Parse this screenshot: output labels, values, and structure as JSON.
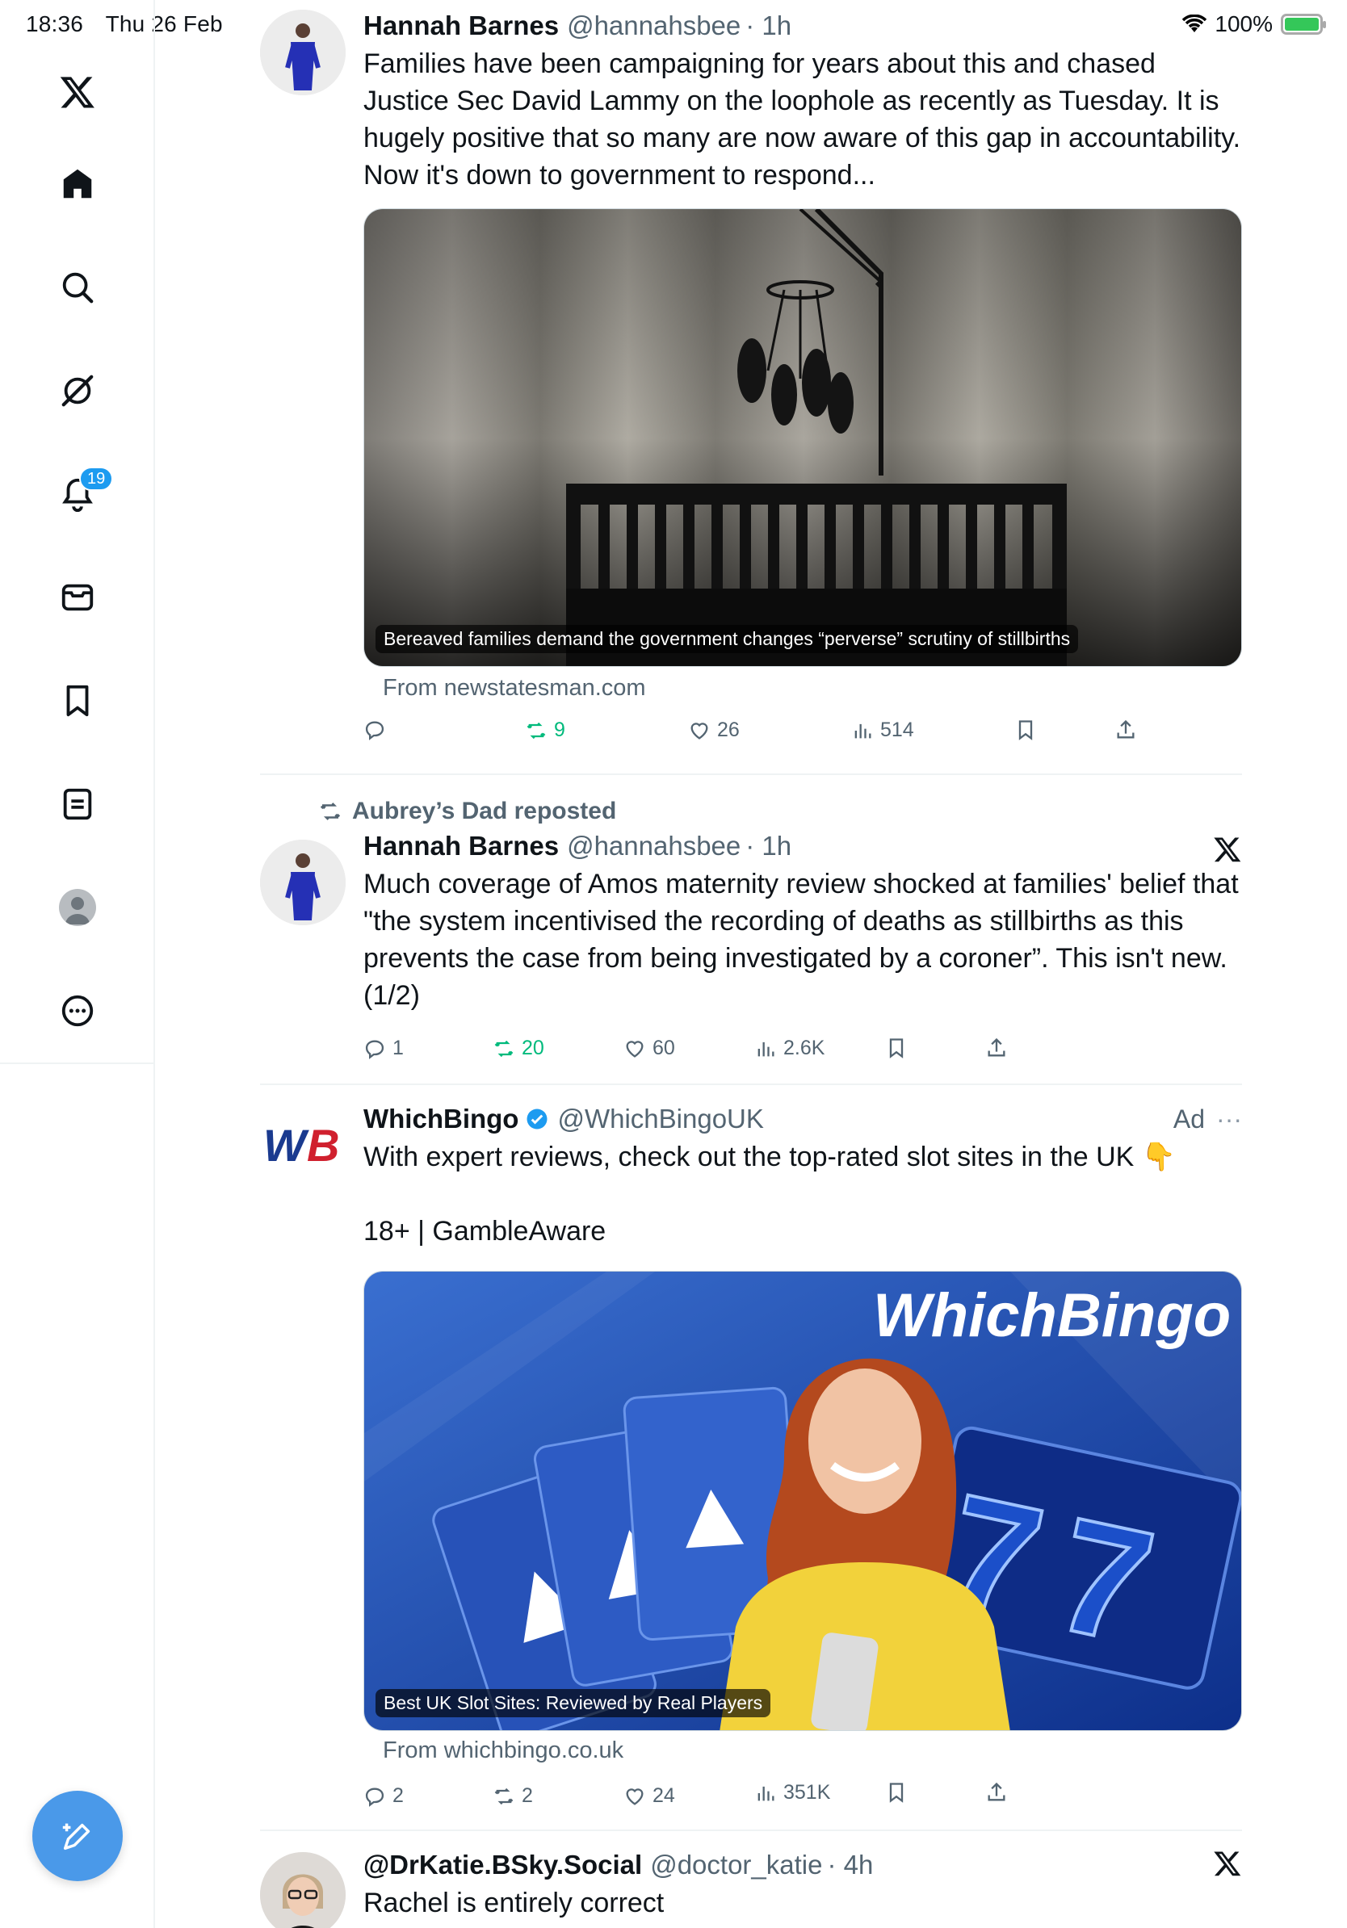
{
  "status_bar": {
    "time": "18:36",
    "date": "Thu 26 Feb",
    "battery": "100%"
  },
  "sidebar": {
    "notifications_badge": "19"
  },
  "tweets": [
    {
      "name": "Hannah Barnes",
      "handle": "@hannahsbee",
      "time": "· 1h",
      "text": "Families have been campaigning for years about this and chased Justice Sec David Lammy on the loophole as recently as Tuesday. It is hugely positive that so many are now aware of this gap in accountability. Now it's down to government to respond...",
      "card_caption": "Bereaved families demand the government changes “perverse” scrutiny of stillbirths",
      "card_source": "From newstatesman.com",
      "replies": "",
      "reposts": "9",
      "likes": "26",
      "views": "514"
    },
    {
      "reposted_by": "Aubrey’s Dad reposted",
      "name": "Hannah Barnes",
      "handle": "@hannahsbee",
      "time": "· 1h",
      "text": "Much coverage of Amos maternity review shocked at families' belief that \"the system incentivised the recording of deaths as stillbirths as this prevents the case from being investigated by a coroner”.  This isn't new. (1/2)",
      "replies": "1",
      "reposts": "20",
      "likes": "60",
      "views": "2.6K"
    },
    {
      "name": "WhichBingo",
      "handle": "@WhichBingoUK",
      "ad_label": "Ad",
      "more": "···",
      "text": "With expert reviews, check out the top-rated slot sites in the UK 👇",
      "text2": "18+ | GambleAware",
      "logo_text": "WB",
      "banner_brand": "WhichBingo",
      "card_caption": "Best UK Slot Sites: Reviewed by Real Players",
      "card_source": "From whichbingo.co.uk",
      "replies": "2",
      "reposts": "2",
      "likes": "24",
      "views": "351K"
    },
    {
      "name": "@DrKatie.BSky.Social",
      "handle": "@doctor_katie",
      "time": "· 4h",
      "text": "Rachel is entirely correct"
    }
  ],
  "colors": {
    "accent": "#1d9bf0",
    "repost_green": "#00ba7c",
    "muted": "#536471"
  }
}
